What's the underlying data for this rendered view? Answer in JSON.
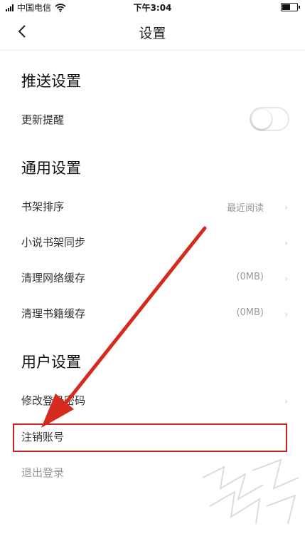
{
  "status_bar": {
    "carrier": "中国电信",
    "time": "下午3:04",
    "battery_level": 0.6
  },
  "nav": {
    "title": "设置"
  },
  "sections": {
    "push": {
      "title": "推送设置",
      "update_reminder": {
        "label": "更新提醒",
        "enabled": false
      }
    },
    "general": {
      "title": "通用设置",
      "items": [
        {
          "label": "书架排序",
          "value": "最近阅读"
        },
        {
          "label": "小说书架同步",
          "value": ""
        },
        {
          "label": "清理网络缓存",
          "value": "(0MB)"
        },
        {
          "label": "清理书籍缓存",
          "value": "(0MB)"
        }
      ]
    },
    "user": {
      "title": "用户设置",
      "items": [
        {
          "label": "修改登录密码"
        },
        {
          "label": "注销账号"
        },
        {
          "label": "退出登录"
        }
      ]
    }
  },
  "colors": {
    "highlight": "#c8211f",
    "arrow": "#d42b1e"
  },
  "icons": [
    "wifi-icon",
    "signal-icon",
    "battery-icon",
    "back-icon",
    "chevron-right-icon"
  ]
}
